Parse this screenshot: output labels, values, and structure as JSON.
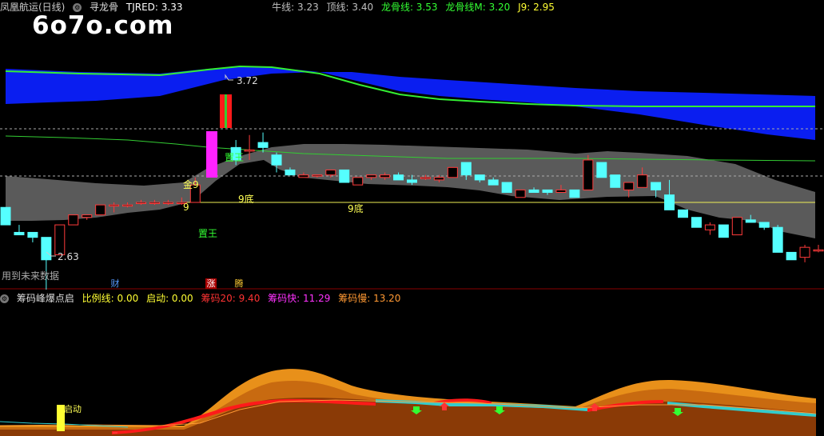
{
  "header": {
    "title": "凤凰航运(日线)",
    "indicator_name": "寻龙骨",
    "items": [
      {
        "label": "TJRED: 3.33",
        "color": "#ffffff"
      },
      {
        "label": "牛线: 3.23",
        "color": "#c0c0c0"
      },
      {
        "label": "顶线: 3.40",
        "color": "#c0c0c0"
      },
      {
        "label": "龙骨线: 3.53",
        "color": "#33ff33"
      },
      {
        "label": "龙骨线M: 3.20",
        "color": "#33ff33"
      },
      {
        "label": "J9: 2.95",
        "color": "#ffff33"
      }
    ]
  },
  "watermark": "6o7o.com",
  "main": {
    "high_label": "3.72",
    "low_label": "2.63",
    "annotations": {
      "gold9": "金9",
      "nine": "9",
      "wang_top": "置王",
      "wang_bottom": "置王",
      "bottom9_a": "9底",
      "bottom9_b": "9底"
    },
    "future_note": "用到未来数据",
    "tags": [
      {
        "label": "财",
        "color": "#5599ff"
      },
      {
        "label": "涨",
        "color": "#ff3333"
      },
      {
        "label": "腾",
        "color": "#ffcc33"
      }
    ]
  },
  "sub_header": {
    "title": "筹码峰爆点启",
    "items": [
      {
        "label": "比例线: 0.00",
        "color": "#ffff33"
      },
      {
        "label": "启动: 0.00",
        "color": "#ffff33"
      },
      {
        "label": "筹码20: 9.40",
        "color": "#ff3333"
      },
      {
        "label": "筹码快: 11.29",
        "color": "#ff33ff"
      },
      {
        "label": "筹码慢: 13.20",
        "color": "#ff9933"
      }
    ]
  },
  "sub": {
    "start_label": "启动"
  },
  "candles": [
    {
      "o": 3.16,
      "h": 3.16,
      "l": 3.09,
      "c": 3.09
    },
    {
      "o": 3.06,
      "h": 3.09,
      "l": 3.05,
      "c": 3.05
    },
    {
      "o": 3.06,
      "h": 3.06,
      "l": 3.02,
      "c": 3.04
    },
    {
      "o": 3.04,
      "h": 3.04,
      "l": 2.63,
      "c": 2.95
    },
    {
      "o": 2.97,
      "h": 3.09,
      "l": 2.97,
      "c": 3.09
    },
    {
      "o": 3.09,
      "h": 3.13,
      "l": 3.09,
      "c": 3.13
    },
    {
      "o": 3.12,
      "h": 3.13,
      "l": 3.11,
      "c": 3.13
    },
    {
      "o": 3.13,
      "h": 3.17,
      "l": 3.13,
      "c": 3.17
    },
    {
      "o": 3.17,
      "h": 3.18,
      "l": 3.14,
      "c": 3.17
    },
    {
      "o": 3.17,
      "h": 3.18,
      "l": 3.16,
      "c": 3.17
    },
    {
      "o": 3.18,
      "h": 3.19,
      "l": 3.17,
      "c": 3.18
    },
    {
      "o": 3.18,
      "h": 3.19,
      "l": 3.17,
      "c": 3.18
    },
    {
      "o": 3.18,
      "h": 3.19,
      "l": 3.17,
      "c": 3.18
    },
    {
      "o": 3.18,
      "h": 3.2,
      "l": 3.17,
      "c": 3.18
    },
    {
      "o": 3.18,
      "h": 3.28,
      "l": 3.18,
      "c": 3.25
    },
    {
      "o": 3.25,
      "h": 3.5,
      "l": 3.25,
      "c": 3.5
    },
    {
      "o": 3.6,
      "h": 3.72,
      "l": 3.6,
      "c": 3.72
    },
    {
      "o": 3.4,
      "h": 3.43,
      "l": 3.33,
      "c": 3.35
    },
    {
      "o": 3.39,
      "h": 3.45,
      "l": 3.35,
      "c": 3.39
    },
    {
      "o": 3.42,
      "h": 3.46,
      "l": 3.38,
      "c": 3.4
    },
    {
      "o": 3.37,
      "h": 3.38,
      "l": 3.3,
      "c": 3.33
    },
    {
      "o": 3.31,
      "h": 3.32,
      "l": 3.29,
      "c": 3.29
    },
    {
      "o": 3.28,
      "h": 3.3,
      "l": 3.28,
      "c": 3.29
    },
    {
      "o": 3.29,
      "h": 3.29,
      "l": 3.28,
      "c": 3.29
    },
    {
      "o": 3.29,
      "h": 3.31,
      "l": 3.28,
      "c": 3.31
    },
    {
      "o": 3.31,
      "h": 3.31,
      "l": 3.26,
      "c": 3.26
    },
    {
      "o": 3.25,
      "h": 3.28,
      "l": 3.25,
      "c": 3.28
    },
    {
      "o": 3.28,
      "h": 3.29,
      "l": 3.27,
      "c": 3.29
    },
    {
      "o": 3.28,
      "h": 3.3,
      "l": 3.27,
      "c": 3.29
    },
    {
      "o": 3.29,
      "h": 3.3,
      "l": 3.27,
      "c": 3.27
    },
    {
      "o": 3.27,
      "h": 3.29,
      "l": 3.25,
      "c": 3.26
    },
    {
      "o": 3.28,
      "h": 3.29,
      "l": 3.27,
      "c": 3.28
    },
    {
      "o": 3.27,
      "h": 3.29,
      "l": 3.26,
      "c": 3.28
    },
    {
      "o": 3.28,
      "h": 3.32,
      "l": 3.28,
      "c": 3.32
    },
    {
      "o": 3.34,
      "h": 3.34,
      "l": 3.27,
      "c": 3.29
    },
    {
      "o": 3.29,
      "h": 3.29,
      "l": 3.26,
      "c": 3.27
    },
    {
      "o": 3.27,
      "h": 3.28,
      "l": 3.25,
      "c": 3.25
    },
    {
      "o": 3.26,
      "h": 3.26,
      "l": 3.22,
      "c": 3.22
    },
    {
      "o": 3.2,
      "h": 3.23,
      "l": 3.2,
      "c": 3.23
    },
    {
      "o": 3.23,
      "h": 3.24,
      "l": 3.22,
      "c": 3.22
    },
    {
      "o": 3.23,
      "h": 3.23,
      "l": 3.21,
      "c": 3.22
    },
    {
      "o": 3.22,
      "h": 3.25,
      "l": 3.22,
      "c": 3.23
    },
    {
      "o": 3.23,
      "h": 3.23,
      "l": 3.2,
      "c": 3.2
    },
    {
      "o": 3.23,
      "h": 3.37,
      "l": 3.23,
      "c": 3.35
    },
    {
      "o": 3.34,
      "h": 3.34,
      "l": 3.28,
      "c": 3.28
    },
    {
      "o": 3.29,
      "h": 3.29,
      "l": 3.24,
      "c": 3.24
    },
    {
      "o": 3.23,
      "h": 3.26,
      "l": 3.2,
      "c": 3.26
    },
    {
      "o": 3.24,
      "h": 3.32,
      "l": 3.24,
      "c": 3.29
    },
    {
      "o": 3.26,
      "h": 3.26,
      "l": 3.2,
      "c": 3.23
    },
    {
      "o": 3.21,
      "h": 3.27,
      "l": 3.15,
      "c": 3.15
    },
    {
      "o": 3.15,
      "h": 3.15,
      "l": 3.12,
      "c": 3.12
    },
    {
      "o": 3.12,
      "h": 3.12,
      "l": 3.08,
      "c": 3.08
    },
    {
      "o": 3.07,
      "h": 3.1,
      "l": 3.05,
      "c": 3.09
    },
    {
      "o": 3.09,
      "h": 3.09,
      "l": 3.04,
      "c": 3.04
    },
    {
      "o": 3.05,
      "h": 3.12,
      "l": 3.05,
      "c": 3.12
    },
    {
      "o": 3.11,
      "h": 3.13,
      "l": 3.1,
      "c": 3.1
    },
    {
      "o": 3.1,
      "h": 3.1,
      "l": 3.07,
      "c": 3.08
    },
    {
      "o": 3.08,
      "h": 3.09,
      "l": 2.98,
      "c": 2.98
    },
    {
      "o": 2.98,
      "h": 2.98,
      "l": 2.95,
      "c": 2.95
    },
    {
      "o": 2.96,
      "h": 3.01,
      "l": 2.94,
      "c": 3.0
    },
    {
      "o": 2.99,
      "h": 3.01,
      "l": 2.98,
      "c": 2.99
    }
  ]
}
